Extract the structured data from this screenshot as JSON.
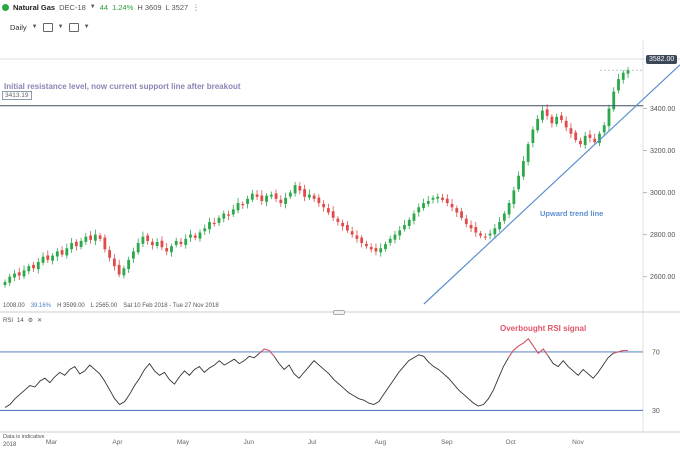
{
  "header": {
    "symbol": "Natural Gas",
    "contract": "DEC-18",
    "change": "44",
    "change_pct": "1.24%",
    "high": "H 3609",
    "low": "L 3527",
    "menu_icon": "vertical-dots-icon"
  },
  "toolbar": {
    "interval": "Daily",
    "chart_type_icon": "chart-type-icon",
    "indicators_icon": "indicator-icon"
  },
  "price_box": "3582.00",
  "support_label": "3413.19",
  "annotations": {
    "resistance": "Initial resistance level, now current support line after breakout",
    "trend": "Upward trend line",
    "overbought": "Overbought RSI signal"
  },
  "info_bar": {
    "volume": "1008.00",
    "pct": "39.16%",
    "high": "H 3599.00",
    "low": "L 2565.00",
    "range": "Sat 10 Feb 2018 - Tue 27 Nov 2018"
  },
  "rsi_panel": {
    "label": "RSI",
    "period": "14"
  },
  "footer": {
    "note": "Data is indicative",
    "year": "2018"
  },
  "colors": {
    "up": "#2aa84a",
    "down": "#e14a4a",
    "trendline": "#5b8fd0",
    "support": "#3f4f66",
    "rsi_line": "#333333",
    "rsi_level": "#3f6fb5"
  },
  "chart_data": [
    {
      "type": "candlestick",
      "y_ticks": [
        2600,
        2800,
        3000,
        3200,
        3400
      ],
      "ylim": [
        2470,
        3640
      ],
      "x_labels": [
        "Mar",
        "Apr",
        "May",
        "Jun",
        "Jul",
        "Aug",
        "Sep",
        "Oct",
        "Nov"
      ],
      "support_level": 3413.19,
      "last_price": 3582.0,
      "trendline": {
        "from": [
          "2018-08-24",
          2470
        ],
        "to": [
          "2018-11-27",
          3430
        ]
      },
      "closes": [
        2575,
        2600,
        2615,
        2605,
        2630,
        2650,
        2640,
        2670,
        2695,
        2680,
        2700,
        2720,
        2705,
        2735,
        2760,
        2745,
        2770,
        2790,
        2775,
        2800,
        2780,
        2730,
        2690,
        2650,
        2610,
        2640,
        2680,
        2720,
        2760,
        2790,
        2770,
        2750,
        2765,
        2740,
        2720,
        2745,
        2770,
        2755,
        2780,
        2800,
        2785,
        2810,
        2830,
        2860,
        2850,
        2880,
        2900,
        2890,
        2920,
        2950,
        2940,
        2970,
        2995,
        2980,
        2960,
        2985,
        2990,
        2970,
        2950,
        2975,
        3000,
        3035,
        3010,
        2980,
        2990,
        2970,
        2950,
        2930,
        2905,
        2880,
        2860,
        2840,
        2820,
        2800,
        2780,
        2760,
        2745,
        2730,
        2720,
        2735,
        2755,
        2780,
        2800,
        2820,
        2845,
        2870,
        2900,
        2930,
        2950,
        2960,
        2975,
        2980,
        2965,
        2950,
        2930,
        2905,
        2880,
        2850,
        2830,
        2810,
        2795,
        2790,
        2805,
        2830,
        2860,
        2900,
        2950,
        3010,
        3080,
        3150,
        3230,
        3300,
        3350,
        3390,
        3365,
        3330,
        3360,
        3345,
        3310,
        3280,
        3250,
        3230,
        3270,
        3260,
        3240,
        3280,
        3320,
        3400,
        3480,
        3540,
        3570,
        3582
      ]
    },
    {
      "type": "line",
      "name": "RSI 14",
      "y_ticks": [
        30,
        70
      ],
      "ylim": [
        20,
        85
      ],
      "overbought": 70,
      "oversold": 30,
      "values": [
        32,
        34,
        38,
        41,
        44,
        47,
        46,
        50,
        52,
        49,
        53,
        56,
        54,
        58,
        60,
        55,
        57,
        61,
        58,
        55,
        50,
        44,
        38,
        34,
        36,
        41,
        47,
        52,
        58,
        62,
        57,
        54,
        56,
        51,
        48,
        53,
        57,
        54,
        58,
        60,
        56,
        59,
        61,
        64,
        61,
        63,
        65,
        62,
        64,
        67,
        66,
        69,
        72,
        71,
        67,
        62,
        58,
        61,
        55,
        52,
        56,
        60,
        64,
        61,
        58,
        55,
        51,
        48,
        45,
        42,
        40,
        38,
        37,
        35,
        34,
        36,
        41,
        46,
        51,
        56,
        60,
        64,
        66,
        68,
        67,
        63,
        60,
        58,
        55,
        52,
        48,
        44,
        41,
        38,
        35,
        33,
        34,
        38,
        44,
        52,
        60,
        66,
        71,
        74,
        76,
        79,
        74,
        69,
        72,
        67,
        62,
        60,
        64,
        60,
        57,
        54,
        58,
        55,
        52,
        56,
        61,
        66,
        69,
        70,
        71,
        71
      ]
    }
  ]
}
